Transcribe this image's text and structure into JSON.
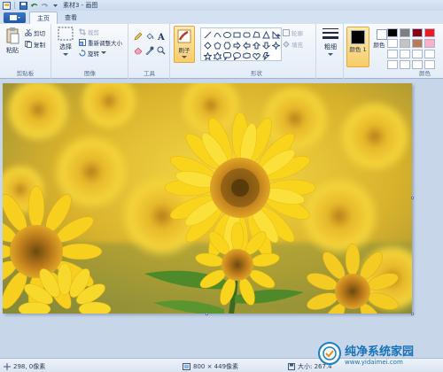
{
  "window": {
    "title": "素材3 - 画图"
  },
  "tabs": [
    {
      "label": "主页",
      "active": true
    },
    {
      "label": "查看",
      "active": false
    }
  ],
  "ribbon": {
    "clipboard": {
      "label": "剪贴板",
      "paste": "粘贴",
      "cut": "剪切",
      "copy": "复制"
    },
    "image": {
      "label": "图像",
      "select": "选择",
      "crop": "裁剪",
      "resize": "重新调整大小",
      "rotate": "旋转"
    },
    "tools": {
      "label": "工具"
    },
    "brush": {
      "label": "刷子"
    },
    "shapes": {
      "label": "形状",
      "outline": "轮廓",
      "fill": "填充"
    },
    "size": {
      "label": "粗细"
    },
    "colors": {
      "label": "颜色",
      "color1": "颜色 1",
      "color2": "颜色 2",
      "color1_value": "#000000",
      "color2_value": "#ffffff",
      "palette": [
        "#000000",
        "#7f7f7f",
        "#880015",
        "#ed1c24",
        "#ffffff",
        "#c3c3c3",
        "#b97a57",
        "#ffaec9",
        "#ffffff",
        "#ffffff",
        "#ffffff",
        "#ffffff",
        "#ffffff",
        "#ffffff",
        "#ffffff",
        "#ffffff"
      ]
    }
  },
  "status": {
    "cursor": "298, 0像素",
    "dimensions": "800 × 449像素",
    "filesize": "大小: 267.4"
  },
  "watermark": {
    "title": "纯净系统家园",
    "url": "www.yidaimei.com"
  },
  "colors": {
    "accent": "#15428b",
    "ribbon_bg": "#e3ecf7",
    "highlight": "#f8cd6a"
  }
}
